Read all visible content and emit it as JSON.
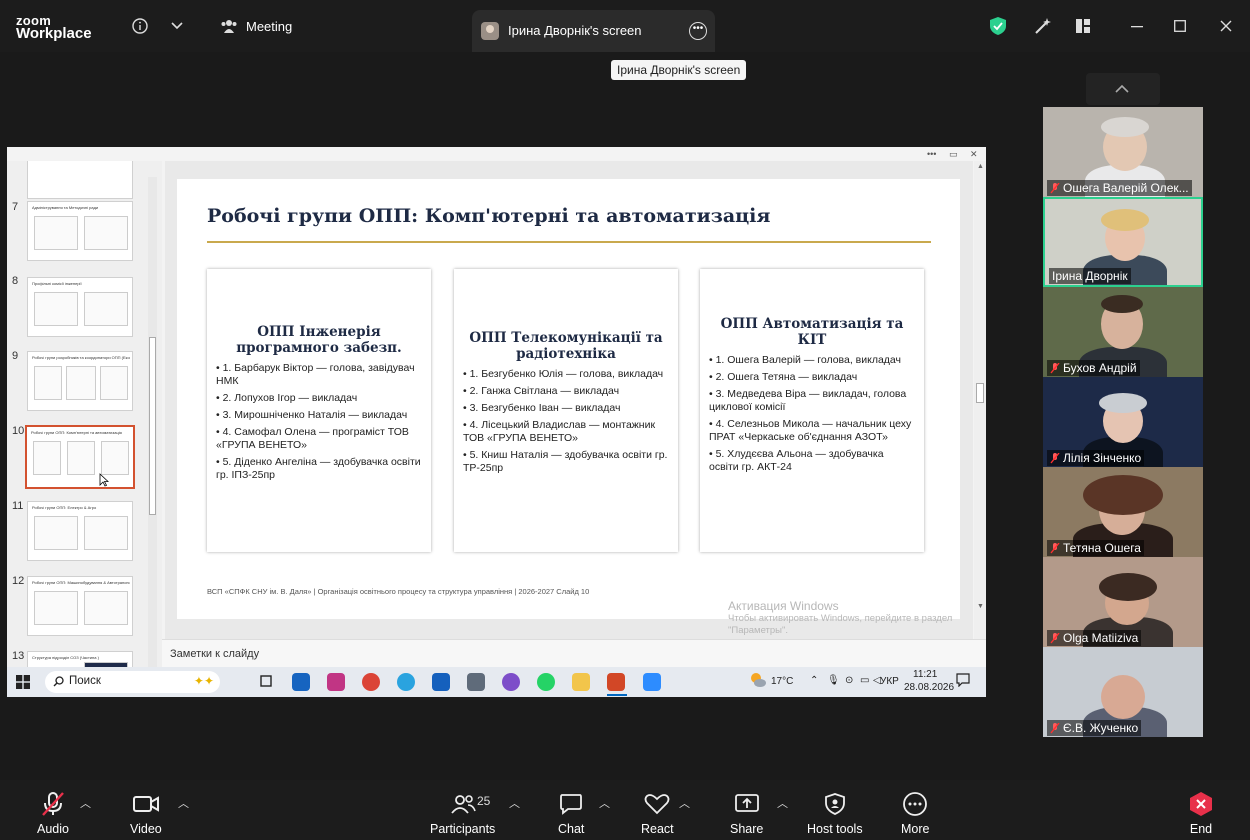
{
  "app": {
    "logo_line1": "zoom",
    "logo_line2": "Workplace"
  },
  "topbar": {
    "meeting_label": "Meeting",
    "screen_tab_title": "Ірина Дворнік's screen",
    "tooltip": "Ірина Дворнік's screen"
  },
  "thumbnails": [
    {
      "num": "7",
      "title": "Адміністрування та Методичні ради"
    },
    {
      "num": "8",
      "title": "Профільні комісії інженерії"
    },
    {
      "num": "9",
      "title": "Робочі групи розробників та координатори ОПП (Економ. & Тех.)"
    },
    {
      "num": "10",
      "title": "Робочі групи ОПП: Комп'ютерні та автоматизація"
    },
    {
      "num": "11",
      "title": "Робочі групи ОПП: Електро & Агро"
    },
    {
      "num": "12",
      "title": "Робочі групи ОПП: Машинобудування & Автотранспорт"
    },
    {
      "num": "13",
      "title": "Структура підрозділ СОЗ (Частина )"
    }
  ],
  "slide": {
    "title": "Робочі групи ОПП: Комп'ютерні та автоматизація",
    "cards": [
      {
        "heading": "ОПП Інженерія програмного забезп.",
        "items": [
          "• 1. Барбарук Віктор — голова, завідувач НМК",
          "• 2. Лопухов Ігор — викладач",
          "• 3. Мирошніченко Наталія — викладач",
          "• 4. Самофал Олена — програміст ТОВ «ГРУПА ВЕНЕТО»",
          "• 5. Діденко Ангеліна — здобувачка освіти гр. ІПЗ-25пр"
        ]
      },
      {
        "heading": "ОПП Телекомунікації та радіотехніка",
        "items": [
          "• 1. Безгубенко Юлія — голова, викладач",
          "• 2. Ганжа Світлана — викладач",
          "• 3. Безгубенко Іван — викладач",
          "• 4. Лісецький Владислав — монтажник ТОВ «ГРУПА ВЕНЕТО»",
          "• 5. Книш Наталія — здобувачка освіти гр. ТР-25пр"
        ]
      },
      {
        "heading": "ОПП Автоматизація та КІТ",
        "items": [
          "• 1. Ошега Валерій — голова, викладач",
          "• 2. Ошега Тетяна — викладач",
          "• 3. Медведева Віра — викладач, голова циклової комісії",
          "• 4. Селезньов Микола — начальник цеху ПРАТ «Черкаське об'єднання АЗОТ»",
          "• 5. Хлудєєва Альона — здобувачка освіти гр. АКТ-24"
        ]
      }
    ],
    "footer": "ВСП «СПФК СНУ ім. В. Даля»  |  Організація освітнього процесу та структура управління  |  2026-2027      Слайд 10"
  },
  "notes_placeholder": "Заметки к слайду",
  "watermark": {
    "line1": "Активация Windows",
    "line2": "Чтобы активировать Windows, перейдите в раздел \"Параметры\"."
  },
  "taskbar": {
    "search": "Поиск",
    "weather": "17°C",
    "lang": "УКР",
    "time": "11:21",
    "date": "28.08.2026"
  },
  "participants": [
    {
      "name": "Ошега Валерій Олек...",
      "muted": true,
      "bg": "#b9b4ad"
    },
    {
      "name": "Ірина Дворнік",
      "muted": false,
      "bg": "#cfd0c8",
      "active": true
    },
    {
      "name": "Бухов Андрій",
      "muted": true,
      "bg": "#5f6a4a"
    },
    {
      "name": "Лілія Зінченко",
      "muted": true,
      "bg": "#1d2a48"
    },
    {
      "name": "Тетяна Ошега",
      "muted": true,
      "bg": "#8c7a62"
    },
    {
      "name": "Olga Matiiziva",
      "muted": true,
      "bg": "#b39a8a"
    },
    {
      "name": "Є.В. Жученко",
      "muted": true,
      "bg": "#c7ccd2"
    }
  ],
  "toolbar": {
    "audio": "Audio",
    "video": "Video",
    "participants": "Participants",
    "participants_count": "25",
    "chat": "Chat",
    "react": "React",
    "share": "Share",
    "host_tools": "Host tools",
    "more": "More",
    "end": "End"
  },
  "colors": {
    "accent_green": "#2cd08f",
    "end_red": "#e8304a",
    "slide_gold": "#c9a94d",
    "active_thumb": "#d35230"
  }
}
